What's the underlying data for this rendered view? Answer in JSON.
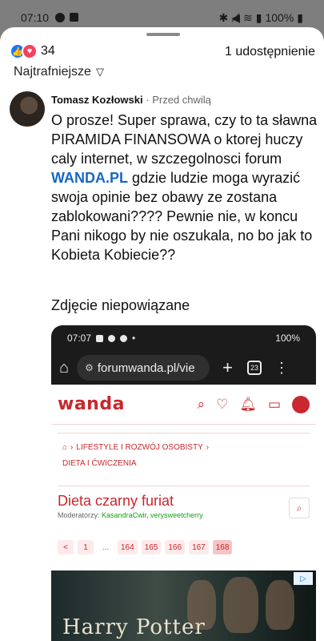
{
  "statusbar": {
    "time": "07:10",
    "battery": "100%"
  },
  "reactions": {
    "count": "34",
    "shares": "1 udostępnienie"
  },
  "sort": {
    "label": "Najtrafniejsze"
  },
  "comment": {
    "author": "Tomasz Kozłowski",
    "separator": "·",
    "time": "Przed chwilą",
    "text_part1": "O prosze! Super sprawa, czy to ta sławna PIRAMIDA FINANSOWA o ktorej huczy caly internet, w szczegolnosci forum ",
    "link": "WANDA.PL",
    "text_part2": "  gdzie ludzie moga wyrazić swoja opinie bez obawy ze zostana zablokowani???? Pewnie nie, w koncu Pani nikogo by nie oszukala, no bo  jak to Kobieta Kobiecie??",
    "caption": "Zdjęcie niepowiązane"
  },
  "screenshot": {
    "status_time": "07:07",
    "status_battery": "100%",
    "url": "forumwanda.pl/vie",
    "tab_count": "23",
    "logo": "wanda",
    "breadcrumb_1": "LIFESTYLE I ROZWÓJ OSOBISTY",
    "breadcrumb_2": "DIETA I ĆWICZENIA",
    "topic_title": "Dieta czarny furiat",
    "moderators_label": "Moderatorzy:",
    "moderators": "KasandraCwir, verysweetcherry",
    "pages": [
      "<",
      "1",
      "...",
      "164",
      "165",
      "166",
      "167",
      "168"
    ],
    "ad_title": "Harry Potter"
  }
}
